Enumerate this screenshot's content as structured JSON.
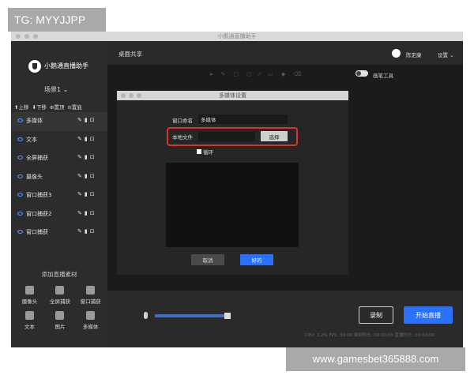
{
  "watermark_top": "TG: MYYJJPP",
  "watermark_bottom": "www.gamesbet365888.com",
  "window": {
    "title": "小鹅通直播助手"
  },
  "sidebar": {
    "app_name": "小鹅通直播助手",
    "scene": "场景1 ⌄",
    "actions": [
      "⬆上移",
      "⬇下移",
      "⊕置顶",
      "⊖置底"
    ],
    "sources": [
      {
        "label": "多媒体"
      },
      {
        "label": "文本"
      },
      {
        "label": "全屏捕获"
      },
      {
        "label": "摄像头"
      },
      {
        "label": "窗口捕获3"
      },
      {
        "label": "窗口捕获2"
      },
      {
        "label": "窗口捕获"
      }
    ],
    "add_title": "添加直播素材",
    "add_items": [
      "摄像头",
      "全屏捕获",
      "窗口捕获",
      "文本",
      "图片",
      "多媒体"
    ]
  },
  "header": {
    "label": "桌面共享",
    "user": "陈定康",
    "settings": "设置 ⌄"
  },
  "canvas": {
    "pen_label": "画笔工具"
  },
  "bottom": {
    "record": "录制",
    "start_live": "开始直播",
    "stats": "CPU: 3.2% FPS: 30.00  录制时长: 00:00:00  直播时长: 00:00:00"
  },
  "dialog": {
    "title": "多媒体设置",
    "name_label": "窗口命名",
    "name_value": "多媒体",
    "file_label": "本地文件",
    "choose": "选择",
    "loop": "循环",
    "cancel": "取消",
    "ok": "好的"
  },
  "colors": {
    "accent": "#2a71ff",
    "highlight": "#e0302a"
  }
}
